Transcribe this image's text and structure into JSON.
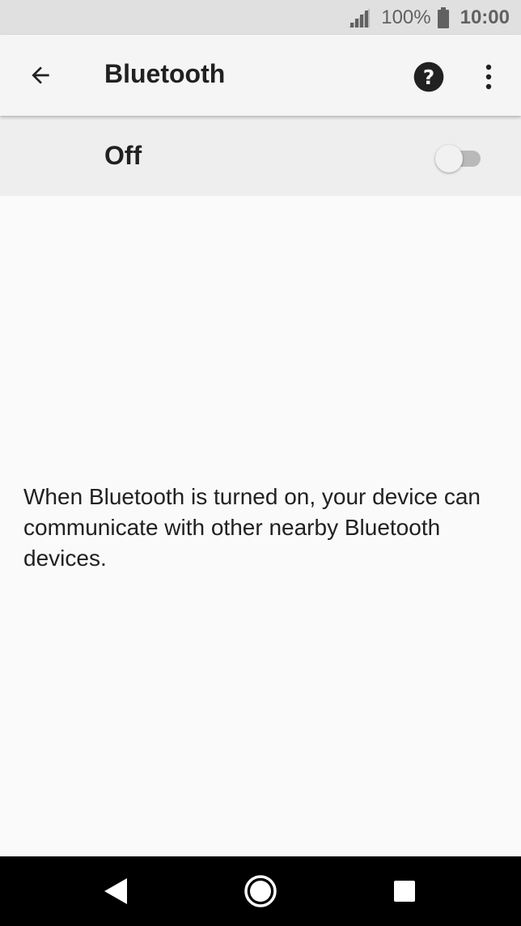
{
  "status_bar": {
    "battery_percent": "100%",
    "time": "10:00",
    "icons": [
      "signal-icon",
      "battery-icon"
    ]
  },
  "app_bar": {
    "title": "Bluetooth",
    "icons": [
      "back-arrow-icon",
      "help-icon",
      "more-vert-icon"
    ]
  },
  "master_switch": {
    "label": "Off",
    "checked": false
  },
  "description": "When Bluetooth is turned on, your device can communicate with other nearby Bluetooth devices.",
  "nav_bar": {
    "icons": [
      "back-triangle-icon",
      "home-circle-icon",
      "recents-square-icon"
    ]
  },
  "colors": {
    "status_bar_bg": "#e0e0e0",
    "app_bar_bg": "#f5f5f5",
    "switch_row_bg": "#eeeeee",
    "page_bg": "#fafafa",
    "nav_bar_bg": "#000000",
    "text_primary": "#212121"
  }
}
